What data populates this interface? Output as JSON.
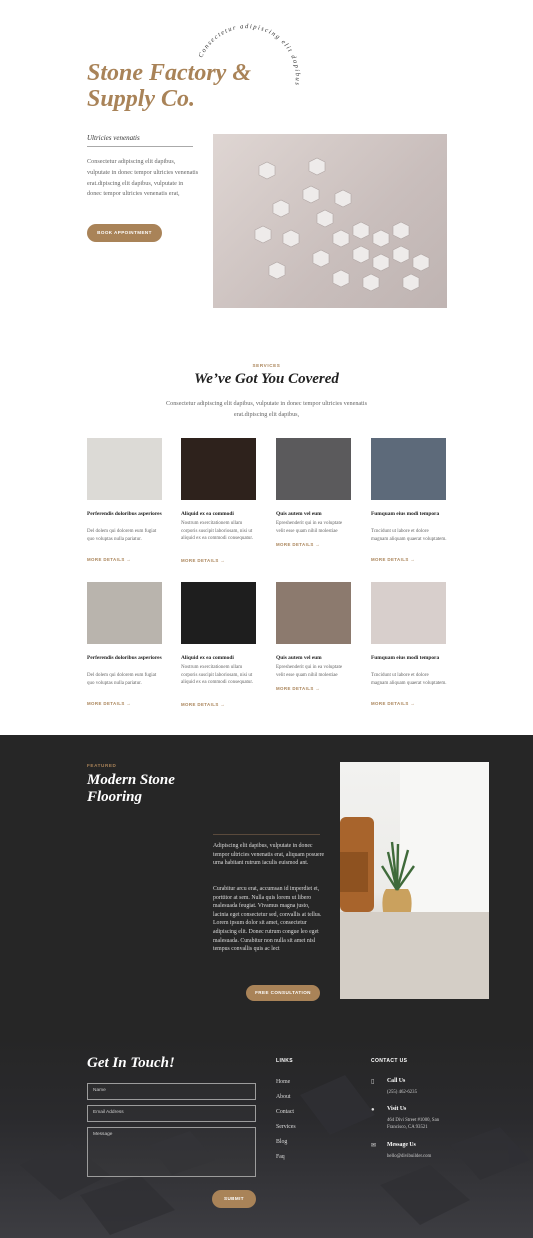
{
  "hero": {
    "title": "Stone Factory & Supply Co.",
    "arc_text": "Consectetur adipiscing elit dapibus",
    "subtitle": "Ultricies venenatis",
    "body": "Consectetur adipiscing elit dapibus, vulputate in donec tempor ultricies venenatis erat.dipiscing elit dapibus, vulputate in donec tempor ultricies venenatis erat,",
    "button": "BOOK APPOINTMENT"
  },
  "services": {
    "kicker": "SERVICES",
    "title": "We’ve Got You Covered",
    "intro": "Consectetur adipiscing elit dapibus, vulputate in donec tempor ultricies venenatis erat.dipiscing elit dapibus,",
    "cards": [
      {
        "title": "Perferendis doloribus asperiores",
        "text": "Del dolem qui dolorem eum fugiat quo voluptas nulla pariatur.",
        "more": "MORE DETAILS →",
        "color": "#dcdad6"
      },
      {
        "title": "Aliquid ex ea commodi",
        "text": "Nostrum exercitationem ullam corporis suscipit laboriosam, nisi ut aliquid ex ea commodi consequatur.",
        "more": "MORE DETAILS →",
        "color": "#2e221c"
      },
      {
        "title": "Quis autem vel eum",
        "text": "Epreshenderit qui in ea voluptate velit esse quam nihil molestiae",
        "more": "MORE DETAILS →",
        "color": "#5b5a5c"
      },
      {
        "title": "Fumquam eius modi tempora",
        "text": "Tcncidunt ut labore et dolore magnam aliquam quaerat voluptatem.",
        "more": "MORE DETAILS →",
        "color": "#5d6a7a"
      },
      {
        "title": "Perferendis doloribus asperiores",
        "text": "Del dolem qui dolorem eum fugiat quo voluptas nulla pariatur.",
        "more": "MORE DETAILS →",
        "color": "#b9b4ad"
      },
      {
        "title": "Aliquid ex ea commodi",
        "text": "Nostrum exercitationem ullam corporis suscipit laboriosam, nisi ut aliquid ex ea commodi consequatur.",
        "more": "MORE DETAILS →",
        "color": "#1e1e1e"
      },
      {
        "title": "Quis autem vel eum",
        "text": "Epreshenderit qui in ea voluptate velit esse quam nihil molestiae",
        "more": "MORE DETAILS →",
        "color": "#8c7a6e"
      },
      {
        "title": "Fumquam eius modi tempora",
        "text": "Tcncidunt ut labore et dolore magnam aliquam quaerat voluptatem.",
        "more": "MORE DETAILS →",
        "color": "#d8cfcc"
      }
    ]
  },
  "featured": {
    "kicker": "FEATURED",
    "title": "Modern Stone Flooring",
    "p1": "Adipiscing elit dapibus, vulputate in donec tempor ultricies venenatis erat, aliquam posuere urna habitant rutrum iaculis euismod ant.",
    "p2": "Curabitur arcu erat, accumsan id imperdiet et, porttitor at sem. Nulla quis lorem ut libero malesuada feugiat. Vivamus magna justo, lacinia eget consectetur sed, convallis at tellus. Lorem ipsum dolor sit amet, consectetur adipiscing elit. Donec rutrum congue leo eget malesuada. Curabitur non nulla sit amet nisl tempus convallis quis ac lect",
    "button": "FREE CONSULTATION"
  },
  "contact": {
    "title": "Get In Touch!",
    "name_placeholder": "Name",
    "email_placeholder": "Email Address",
    "message_placeholder": "Message",
    "submit": "SUBMIT",
    "links_head": "LINKS",
    "links": [
      "Home",
      "About",
      "Contact",
      "Services",
      "Blog",
      "Faq"
    ],
    "contact_head": "CONTACT US",
    "call_label": "Call Us",
    "phone": "(255) 462-6235",
    "visit_label": "Visit Us",
    "address": "464 Divi Street #1000, San Francisco, CA 93521",
    "message_label": "Message Us",
    "email": "hello@divibuilder.com"
  },
  "colors": {
    "accent": "#a98358",
    "dark": "#262626"
  }
}
